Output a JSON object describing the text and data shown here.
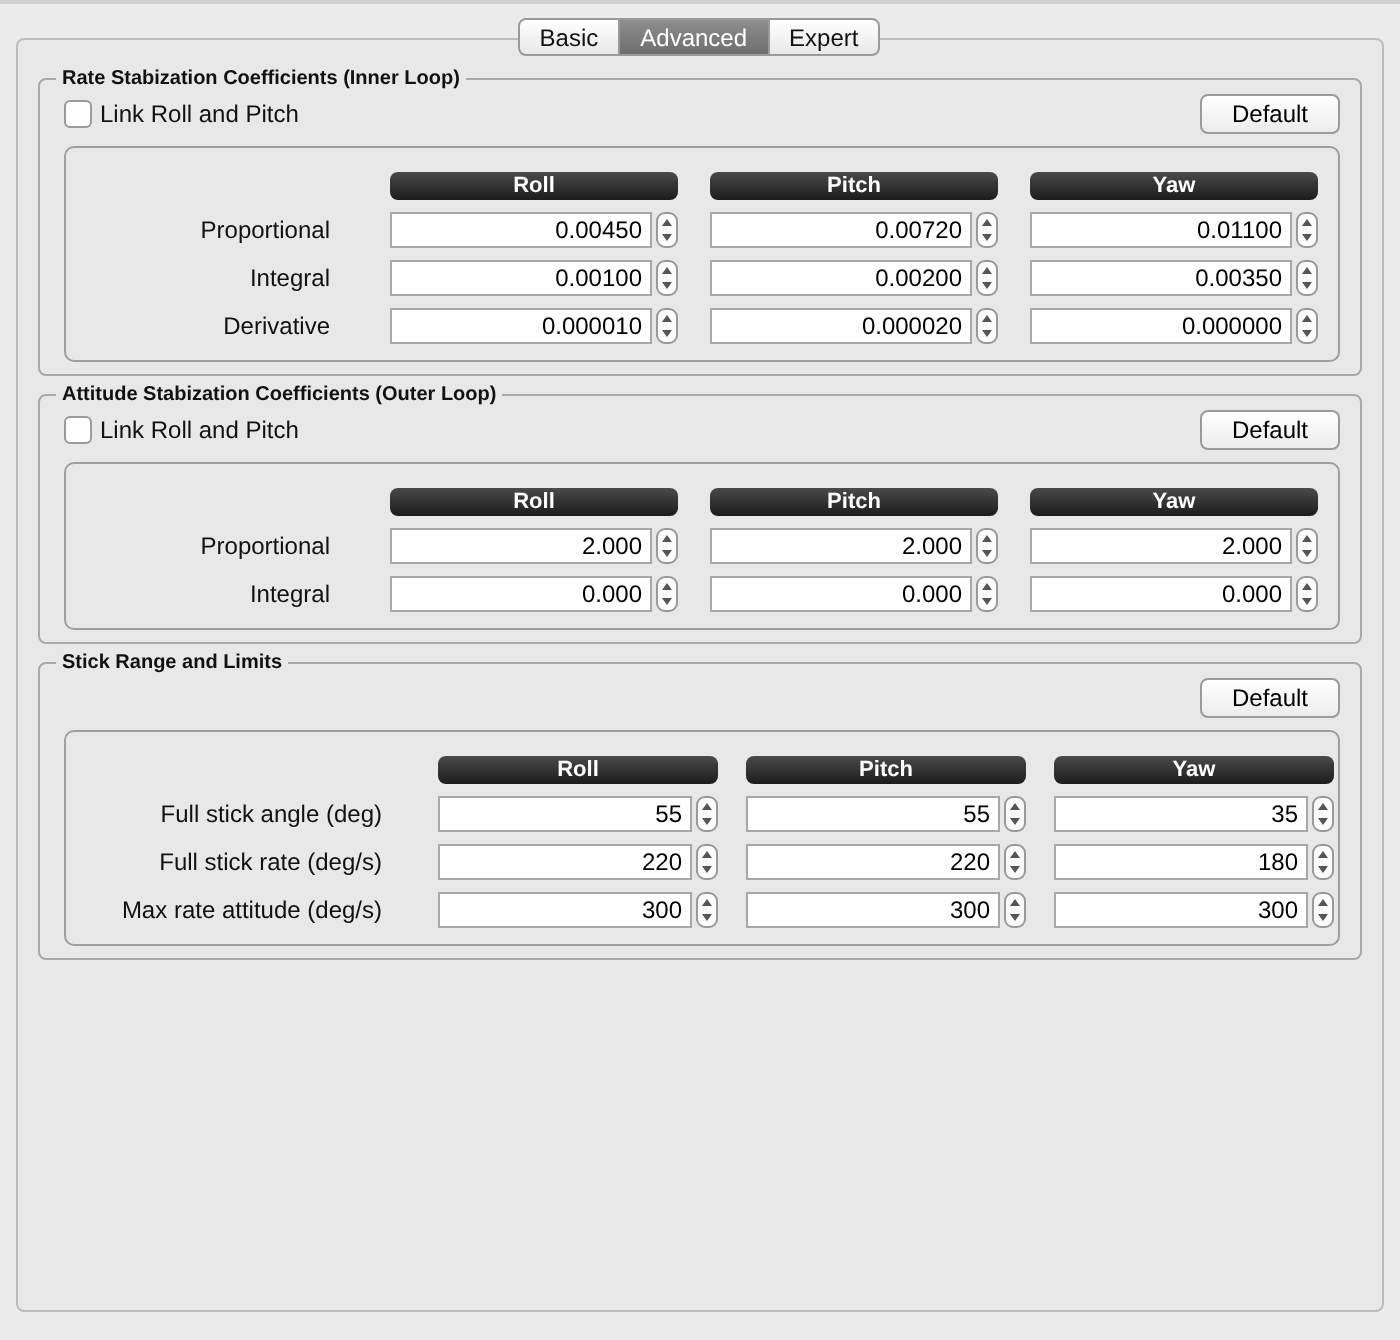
{
  "tabs": [
    {
      "label": "Basic",
      "selected": false
    },
    {
      "label": "Advanced",
      "selected": true
    },
    {
      "label": "Expert",
      "selected": false
    }
  ],
  "sections": [
    {
      "title": "Rate Stabization Coefficients (Inner Loop)",
      "link": {
        "label": "Link Roll and Pitch",
        "checked": false
      },
      "default_button": "Default",
      "columns": [
        "Roll",
        "Pitch",
        "Yaw"
      ],
      "rows": [
        {
          "label": "Proportional",
          "values": [
            "0.00450",
            "0.00720",
            "0.01100"
          ]
        },
        {
          "label": "Integral",
          "values": [
            "0.00100",
            "0.00200",
            "0.00350"
          ]
        },
        {
          "label": "Derivative",
          "values": [
            "0.000010",
            "0.000020",
            "0.000000"
          ]
        }
      ]
    },
    {
      "title": "Attitude Stabization Coefficients (Outer Loop)",
      "link": {
        "label": "Link Roll and Pitch",
        "checked": false
      },
      "default_button": "Default",
      "columns": [
        "Roll",
        "Pitch",
        "Yaw"
      ],
      "rows": [
        {
          "label": "Proportional",
          "values": [
            "2.000",
            "2.000",
            "2.000"
          ]
        },
        {
          "label": "Integral",
          "values": [
            "0.000",
            "0.000",
            "0.000"
          ]
        }
      ]
    },
    {
      "title": "Stick Range and Limits",
      "default_button": "Default",
      "columns": [
        "Roll",
        "Pitch",
        "Yaw"
      ],
      "rows": [
        {
          "label": "Full stick angle (deg)",
          "values": [
            "55",
            "55",
            "35"
          ]
        },
        {
          "label": "Full stick rate (deg/s)",
          "values": [
            "220",
            "220",
            "180"
          ]
        },
        {
          "label": "Max rate attitude (deg/s)",
          "values": [
            "300",
            "300",
            "300"
          ]
        }
      ]
    }
  ]
}
